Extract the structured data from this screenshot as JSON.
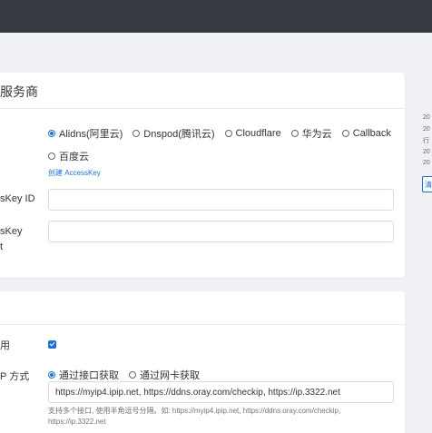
{
  "provider_card": {
    "title": "服务商",
    "providers": [
      {
        "label": "Alidns(阿里云)",
        "checked": true
      },
      {
        "label": "Dnspod(腾讯云)",
        "checked": false
      },
      {
        "label": "Cloudflare",
        "checked": false
      },
      {
        "label": "华为云",
        "checked": false
      },
      {
        "label": "Callback",
        "checked": false
      },
      {
        "label": "百度云",
        "checked": false
      }
    ],
    "create_key_link": "创建 AccessKey",
    "access_key_id_label": "sKey ID",
    "access_key_secret_label_1": "sKey",
    "access_key_secret_label_2": "t",
    "access_key_id_value": "",
    "access_key_secret_value": ""
  },
  "ipv4_card": {
    "enabled_label": "用",
    "enabled": true,
    "method_label": "P 方式",
    "methods": [
      {
        "label": "通过接口获取",
        "checked": true
      },
      {
        "label": "通过网卡获取",
        "checked": false
      }
    ],
    "url_value": "https://myip4.ipip.net, https://ddns.oray.com/checkip, https://ip.3322.net",
    "help_line_1": "支持多个接口, 使用半角逗号分隔。如:   https://myip4.ipip.net, https://ddns.oray.com/checkip,",
    "help_line_2": "https://ip.3322.net"
  },
  "side_panel": {
    "lines": [
      "20",
      "20",
      "行",
      "20",
      "20"
    ],
    "button_label": "清"
  },
  "colors": {
    "accent": "#1f6fd1",
    "topbar": "#343a40",
    "background": "#eff1f4"
  }
}
